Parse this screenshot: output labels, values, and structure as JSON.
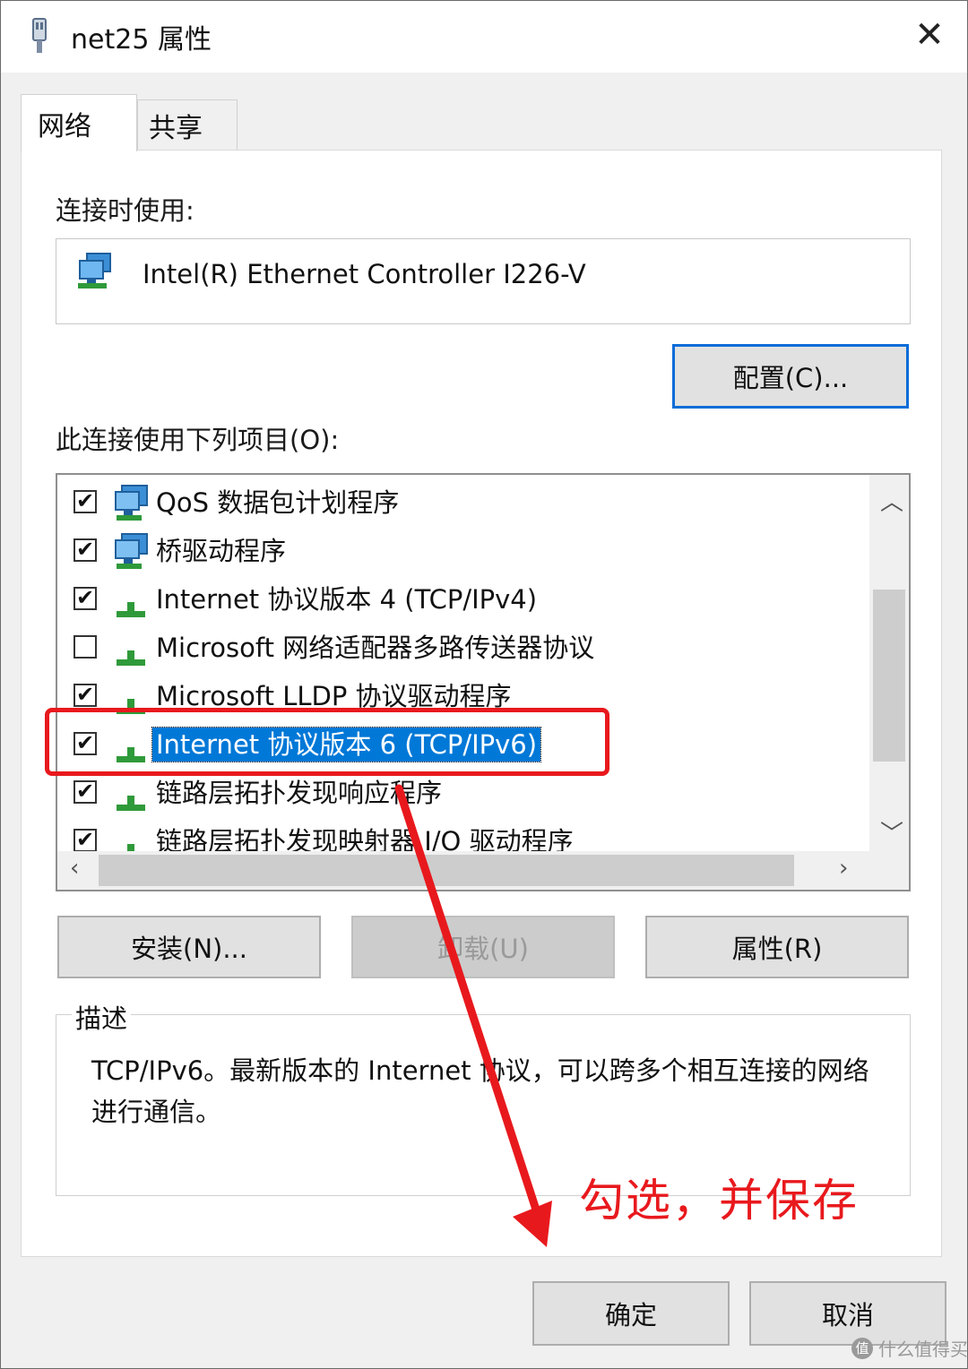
{
  "window": {
    "title": "net25 属性",
    "close_glyph": "✕"
  },
  "tabs": [
    {
      "label": "网络",
      "active": true
    },
    {
      "label": "共享",
      "active": false
    }
  ],
  "connect_using": {
    "label": "连接时使用:",
    "adapter_name": "Intel(R) Ethernet Controller I226-V",
    "configure_button": "配置(C)..."
  },
  "items_section": {
    "label": "此连接使用下列项目(O):",
    "items": [
      {
        "label": "QoS 数据包计划程序",
        "checked": true,
        "icon": "network-service-icon",
        "selected": false
      },
      {
        "label": "桥驱动程序",
        "checked": true,
        "icon": "network-service-icon",
        "selected": false
      },
      {
        "label": "Internet 协议版本 4 (TCP/IPv4)",
        "checked": true,
        "icon": "protocol-icon",
        "selected": false
      },
      {
        "label": "Microsoft 网络适配器多路传送器协议",
        "checked": false,
        "icon": "protocol-icon",
        "selected": false
      },
      {
        "label": "Microsoft LLDP 协议驱动程序",
        "checked": true,
        "icon": "protocol-icon",
        "selected": false
      },
      {
        "label": "Internet 协议版本 6 (TCP/IPv6)",
        "checked": true,
        "icon": "protocol-icon",
        "selected": true
      },
      {
        "label": "链路层拓扑发现响应程序",
        "checked": true,
        "icon": "protocol-icon",
        "selected": false
      },
      {
        "label": "链路层拓扑发现映射器 I/O 驱动程序",
        "checked": true,
        "icon": "protocol-icon",
        "selected": false
      }
    ],
    "check_glyph": "✔"
  },
  "action_buttons": {
    "install": "安装(N)...",
    "uninstall": "卸载(U)",
    "properties": "属性(R)"
  },
  "description": {
    "legend": "描述",
    "text": "TCP/IPv6。最新版本的 Internet 协议，可以跨多个相互连接的网络进行通信。"
  },
  "footer_buttons": {
    "ok": "确定",
    "cancel": "取消"
  },
  "annotation": {
    "text": "勾选，并保存",
    "color": "#e8191d"
  },
  "watermark": {
    "text": "什么值得买",
    "logo": "值"
  },
  "colors": {
    "selection": "#0078d7",
    "focus_border": "#0a6cd8"
  }
}
